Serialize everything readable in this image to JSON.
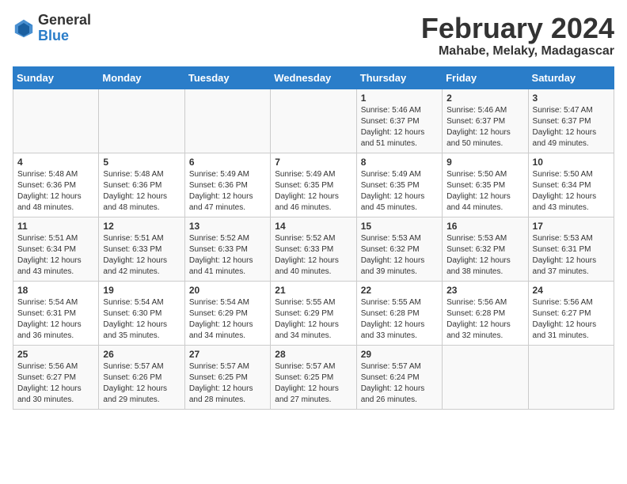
{
  "logo": {
    "general": "General",
    "blue": "Blue"
  },
  "title": "February 2024",
  "subtitle": "Mahabe, Melaky, Madagascar",
  "days_of_week": [
    "Sunday",
    "Monday",
    "Tuesday",
    "Wednesday",
    "Thursday",
    "Friday",
    "Saturday"
  ],
  "weeks": [
    [
      {
        "day": "",
        "sunrise": "",
        "sunset": "",
        "daylight": ""
      },
      {
        "day": "",
        "sunrise": "",
        "sunset": "",
        "daylight": ""
      },
      {
        "day": "",
        "sunrise": "",
        "sunset": "",
        "daylight": ""
      },
      {
        "day": "",
        "sunrise": "",
        "sunset": "",
        "daylight": ""
      },
      {
        "day": "1",
        "sunrise": "Sunrise: 5:46 AM",
        "sunset": "Sunset: 6:37 PM",
        "daylight": "Daylight: 12 hours and 51 minutes."
      },
      {
        "day": "2",
        "sunrise": "Sunrise: 5:46 AM",
        "sunset": "Sunset: 6:37 PM",
        "daylight": "Daylight: 12 hours and 50 minutes."
      },
      {
        "day": "3",
        "sunrise": "Sunrise: 5:47 AM",
        "sunset": "Sunset: 6:37 PM",
        "daylight": "Daylight: 12 hours and 49 minutes."
      }
    ],
    [
      {
        "day": "4",
        "sunrise": "Sunrise: 5:48 AM",
        "sunset": "Sunset: 6:36 PM",
        "daylight": "Daylight: 12 hours and 48 minutes."
      },
      {
        "day": "5",
        "sunrise": "Sunrise: 5:48 AM",
        "sunset": "Sunset: 6:36 PM",
        "daylight": "Daylight: 12 hours and 48 minutes."
      },
      {
        "day": "6",
        "sunrise": "Sunrise: 5:49 AM",
        "sunset": "Sunset: 6:36 PM",
        "daylight": "Daylight: 12 hours and 47 minutes."
      },
      {
        "day": "7",
        "sunrise": "Sunrise: 5:49 AM",
        "sunset": "Sunset: 6:35 PM",
        "daylight": "Daylight: 12 hours and 46 minutes."
      },
      {
        "day": "8",
        "sunrise": "Sunrise: 5:49 AM",
        "sunset": "Sunset: 6:35 PM",
        "daylight": "Daylight: 12 hours and 45 minutes."
      },
      {
        "day": "9",
        "sunrise": "Sunrise: 5:50 AM",
        "sunset": "Sunset: 6:35 PM",
        "daylight": "Daylight: 12 hours and 44 minutes."
      },
      {
        "day": "10",
        "sunrise": "Sunrise: 5:50 AM",
        "sunset": "Sunset: 6:34 PM",
        "daylight": "Daylight: 12 hours and 43 minutes."
      }
    ],
    [
      {
        "day": "11",
        "sunrise": "Sunrise: 5:51 AM",
        "sunset": "Sunset: 6:34 PM",
        "daylight": "Daylight: 12 hours and 43 minutes."
      },
      {
        "day": "12",
        "sunrise": "Sunrise: 5:51 AM",
        "sunset": "Sunset: 6:33 PM",
        "daylight": "Daylight: 12 hours and 42 minutes."
      },
      {
        "day": "13",
        "sunrise": "Sunrise: 5:52 AM",
        "sunset": "Sunset: 6:33 PM",
        "daylight": "Daylight: 12 hours and 41 minutes."
      },
      {
        "day": "14",
        "sunrise": "Sunrise: 5:52 AM",
        "sunset": "Sunset: 6:33 PM",
        "daylight": "Daylight: 12 hours and 40 minutes."
      },
      {
        "day": "15",
        "sunrise": "Sunrise: 5:53 AM",
        "sunset": "Sunset: 6:32 PM",
        "daylight": "Daylight: 12 hours and 39 minutes."
      },
      {
        "day": "16",
        "sunrise": "Sunrise: 5:53 AM",
        "sunset": "Sunset: 6:32 PM",
        "daylight": "Daylight: 12 hours and 38 minutes."
      },
      {
        "day": "17",
        "sunrise": "Sunrise: 5:53 AM",
        "sunset": "Sunset: 6:31 PM",
        "daylight": "Daylight: 12 hours and 37 minutes."
      }
    ],
    [
      {
        "day": "18",
        "sunrise": "Sunrise: 5:54 AM",
        "sunset": "Sunset: 6:31 PM",
        "daylight": "Daylight: 12 hours and 36 minutes."
      },
      {
        "day": "19",
        "sunrise": "Sunrise: 5:54 AM",
        "sunset": "Sunset: 6:30 PM",
        "daylight": "Daylight: 12 hours and 35 minutes."
      },
      {
        "day": "20",
        "sunrise": "Sunrise: 5:54 AM",
        "sunset": "Sunset: 6:29 PM",
        "daylight": "Daylight: 12 hours and 34 minutes."
      },
      {
        "day": "21",
        "sunrise": "Sunrise: 5:55 AM",
        "sunset": "Sunset: 6:29 PM",
        "daylight": "Daylight: 12 hours and 34 minutes."
      },
      {
        "day": "22",
        "sunrise": "Sunrise: 5:55 AM",
        "sunset": "Sunset: 6:28 PM",
        "daylight": "Daylight: 12 hours and 33 minutes."
      },
      {
        "day": "23",
        "sunrise": "Sunrise: 5:56 AM",
        "sunset": "Sunset: 6:28 PM",
        "daylight": "Daylight: 12 hours and 32 minutes."
      },
      {
        "day": "24",
        "sunrise": "Sunrise: 5:56 AM",
        "sunset": "Sunset: 6:27 PM",
        "daylight": "Daylight: 12 hours and 31 minutes."
      }
    ],
    [
      {
        "day": "25",
        "sunrise": "Sunrise: 5:56 AM",
        "sunset": "Sunset: 6:27 PM",
        "daylight": "Daylight: 12 hours and 30 minutes."
      },
      {
        "day": "26",
        "sunrise": "Sunrise: 5:57 AM",
        "sunset": "Sunset: 6:26 PM",
        "daylight": "Daylight: 12 hours and 29 minutes."
      },
      {
        "day": "27",
        "sunrise": "Sunrise: 5:57 AM",
        "sunset": "Sunset: 6:25 PM",
        "daylight": "Daylight: 12 hours and 28 minutes."
      },
      {
        "day": "28",
        "sunrise": "Sunrise: 5:57 AM",
        "sunset": "Sunset: 6:25 PM",
        "daylight": "Daylight: 12 hours and 27 minutes."
      },
      {
        "day": "29",
        "sunrise": "Sunrise: 5:57 AM",
        "sunset": "Sunset: 6:24 PM",
        "daylight": "Daylight: 12 hours and 26 minutes."
      },
      {
        "day": "",
        "sunrise": "",
        "sunset": "",
        "daylight": ""
      },
      {
        "day": "",
        "sunrise": "",
        "sunset": "",
        "daylight": ""
      }
    ]
  ]
}
